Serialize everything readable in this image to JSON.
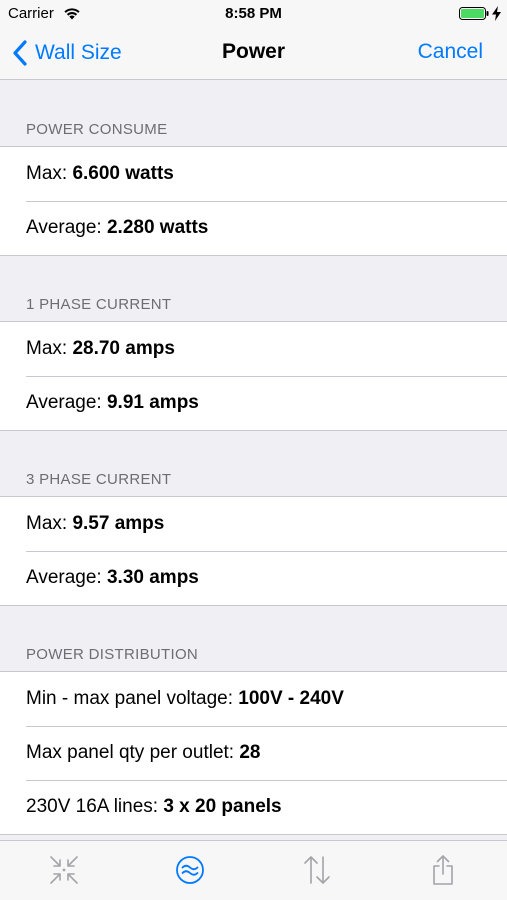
{
  "status_bar": {
    "carrier": "Carrier",
    "time": "8:58 PM",
    "battery_color": "#4cd964"
  },
  "nav": {
    "back_label": "Wall Size",
    "title": "Power",
    "cancel_label": "Cancel",
    "accent_color": "#007aff"
  },
  "sections": [
    {
      "header": "POWER CONSUME",
      "rows": [
        {
          "label": "Max: ",
          "value": "6.600 watts"
        },
        {
          "label": "Average: ",
          "value": "2.280 watts"
        }
      ]
    },
    {
      "header": "1 PHASE CURRENT",
      "rows": [
        {
          "label": "Max: ",
          "value": "28.70 amps"
        },
        {
          "label": "Average: ",
          "value": "9.91 amps"
        }
      ]
    },
    {
      "header": "3 PHASE CURRENT",
      "rows": [
        {
          "label": "Max: ",
          "value": "9.57 amps"
        },
        {
          "label": "Average: ",
          "value": "3.30 amps"
        }
      ]
    },
    {
      "header": "POWER DISTRIBUTION",
      "rows": [
        {
          "label": "Min - max panel voltage: ",
          "value": "100V - 240V"
        },
        {
          "label": "Max panel qty per outlet: ",
          "value": "28"
        },
        {
          "label": "230V 16A lines: ",
          "value": "3 x 20 panels"
        }
      ]
    }
  ],
  "tab_bar": {
    "tabs": [
      {
        "icon": "shrink-arrows-icon",
        "selected": false
      },
      {
        "icon": "approx-power-icon",
        "selected": true
      },
      {
        "icon": "up-down-arrows-icon",
        "selected": false
      },
      {
        "icon": "share-icon",
        "selected": false
      }
    ]
  }
}
